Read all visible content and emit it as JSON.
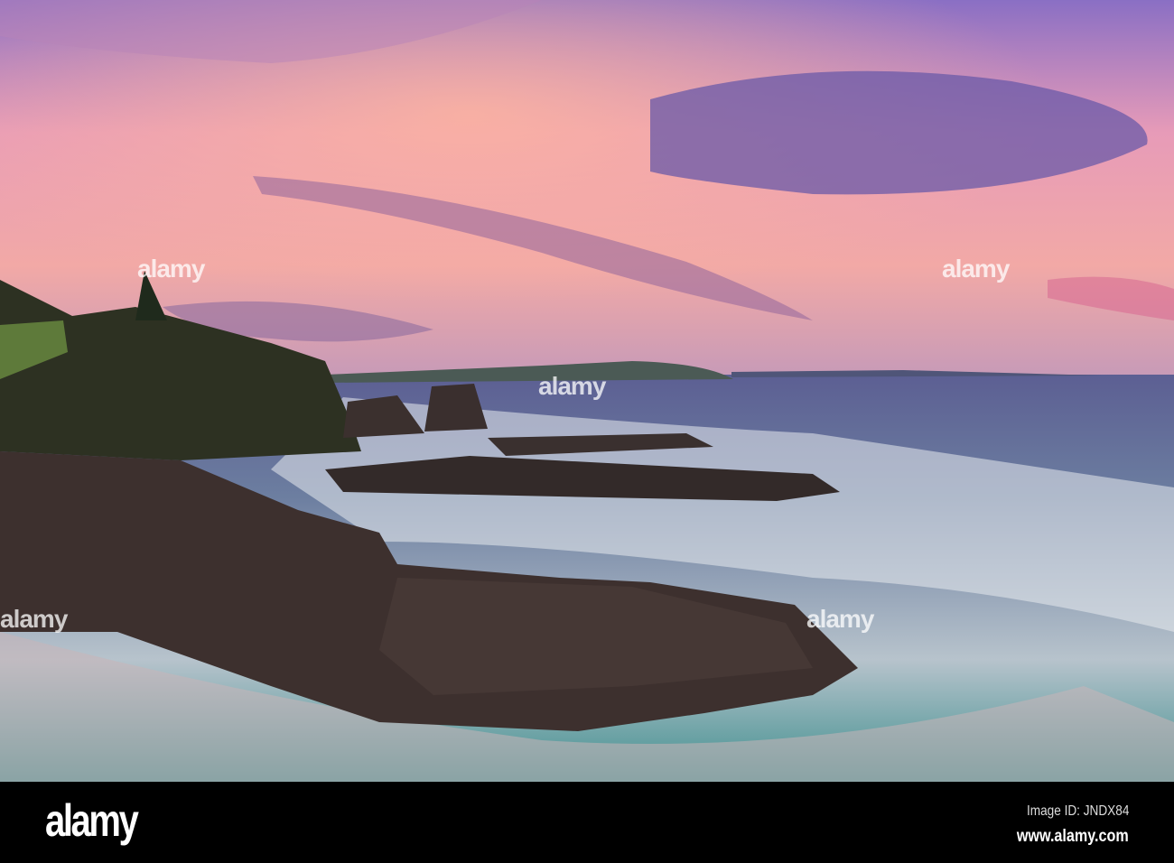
{
  "watermark": {
    "logo": "alamy",
    "center_text": "alamy"
  },
  "footer": {
    "logo": "alamy",
    "image_id": "Image ID: JNDX84",
    "url": "www.alamy.com"
  }
}
